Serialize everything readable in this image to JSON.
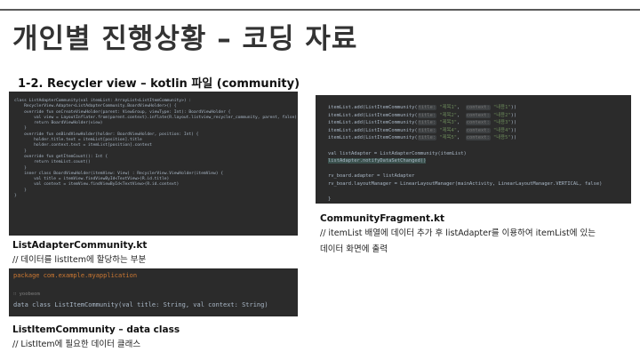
{
  "slide": {
    "title": "개인별 진행상황 – 코딩 자료",
    "subtitle": "1-2. Recycler view – kotlin 파일 (community)"
  },
  "code_blocks": {
    "list_adapter": {
      "lines": [
        "class ListAdapterCommunity(val itemList: ArrayList<ListItemCommunity>) :",
        "    RecyclerView.Adapter<ListAdapterCommunity.BoardViewHolder>() {",
        "",
        "    override fun onCreateViewHolder(parent: ViewGroup, viewType: Int): BoardViewHolder {",
        "        val view = LayoutInflater.from(parent.context).inflate(R.layout.listview_recycler_community, parent, false)",
        "        return BoardViewHolder(view)",
        "    }",
        "",
        "    override fun onBindViewHolder(holder: BoardViewHolder, position: Int) {",
        "        holder.title.text = itemList[position].title",
        "        holder.context.text = itemList[position].context",
        "    }",
        "",
        "    override fun getItemCount(): Int {",
        "        return itemList.count()",
        "    }",
        "",
        "    inner class BoardViewHolder(itemView: View) : RecyclerView.ViewHolder(itemView) {",
        "        val title = itemView.findViewById<TextView>(R.id.title)",
        "        val context = itemView.findViewById<TextView>(R.id.context)",
        "    }",
        "}"
      ]
    },
    "fragment": {
      "add_prefix": "itemList.add(ListItemCommunity(",
      "title_hint": "title:",
      "context_hint": "context:",
      "rows": [
        {
          "title": "\"제목1\"",
          "context": "\"내용1\""
        },
        {
          "title": "\"제목2\"",
          "context": "\"내용2\""
        },
        {
          "title": "\"제목3\"",
          "context": "\"내용3\""
        },
        {
          "title": "\"제목4\"",
          "context": "\"내용4\""
        },
        {
          "title": "\"제목5\"",
          "context": "\"내용5\""
        }
      ],
      "adapter_line": "val listAdapter = ListAdapterCommunity(itemList)",
      "notify_line": "listAdapter.notifyDataSetChanged()",
      "board_adapter_line": "rv_board.adapter = listAdapter",
      "board_layout_line": "rv_board.layoutManager = LinearLayoutManager(mainActivity, LinearLayoutManager.VERTICAL, false)",
      "close_line": "}"
    },
    "data_class": {
      "package_line": "package com.example.myapplication",
      "author_line": "∷ yoobeom",
      "class_line": "data class ListItemCommunity(val title: String, val context: String)"
    }
  },
  "captions": {
    "list_adapter_label": "ListAdapterCommunity.kt",
    "list_adapter_desc": "// 데이터를 listItem에 할당하는 부분",
    "data_class_label": "ListItemCommunity – data class",
    "data_class_desc": "// ListItem에 필요한 데이터 클래스",
    "fragment_label": "CommunityFragment.kt",
    "fragment_desc_1": "// itemList 배열에 데이터 추가 후 listAdapter를 이용하여 itemList에 있는",
    "fragment_desc_2": "데이터 화면에 출력"
  },
  "colors": {
    "code_bg": "#2b2b2b",
    "keyword": "#cc7832",
    "function": "#ffc66d",
    "string": "#6a8759",
    "property": "#9876aa"
  }
}
